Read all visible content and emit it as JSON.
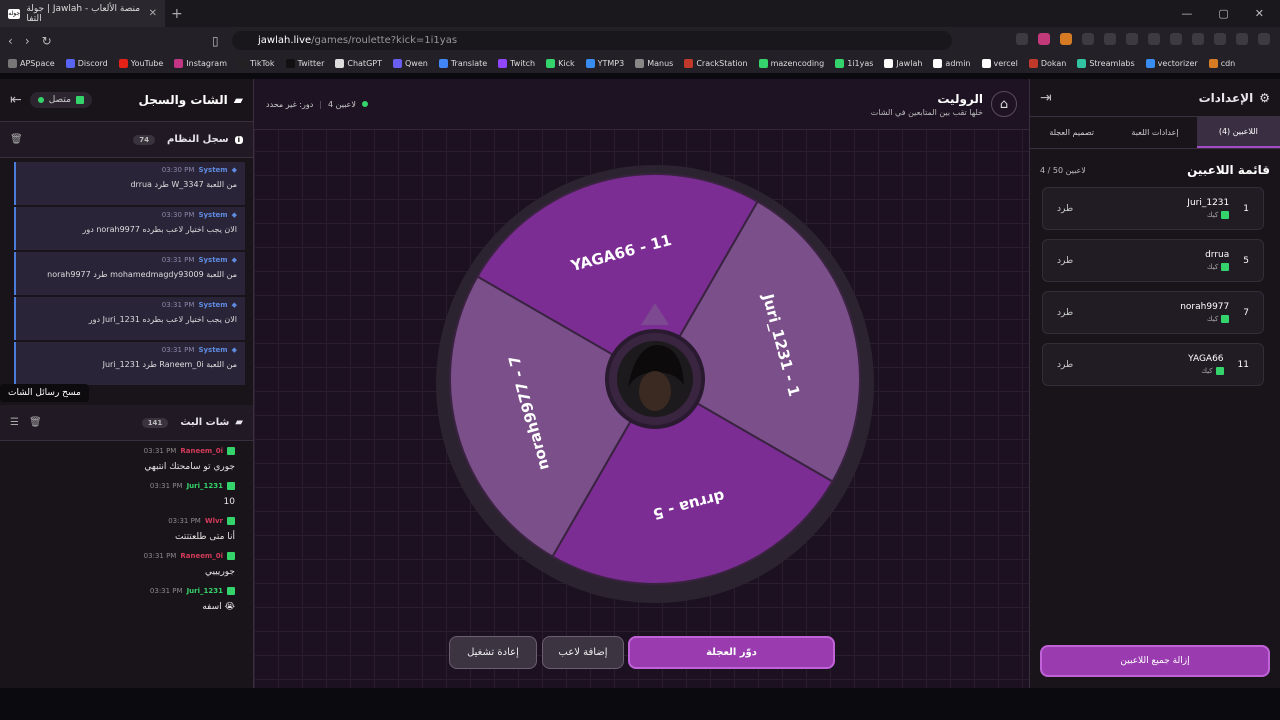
{
  "browser": {
    "tab_title": "جولة | Jawlah - منصة الألعاب التفا",
    "tab_fav": "جوله",
    "url_site": "jawlah.live",
    "url_path": "/games/roulette?kick=1i1yas"
  },
  "bookmarks": [
    "APSpace",
    "Discord",
    "YouTube",
    "Instagram",
    "TikTok",
    "Twitter",
    "ChatGPT",
    "Qwen",
    "Translate",
    "Twitch",
    "Kick",
    "YTMP3",
    "Manus",
    "CrackStation",
    "mazencoding",
    "1i1yas",
    "Jawlah",
    "admin",
    "vercel",
    "Dokan",
    "Streamlabs",
    "vectorizer",
    "cdn"
  ],
  "left": {
    "title": "الشات والسجل",
    "status": "متصل",
    "system_log": {
      "title": "سجل النظام",
      "count": "74"
    },
    "system_messages": [
      {
        "author": "System",
        "time": "03:30 PM",
        "text": "drrua طرد W_3347 من اللعبة"
      },
      {
        "author": "System",
        "time": "03:30 PM",
        "text": "دور norah9977 الان يجب اختيار لاعب بطرده"
      },
      {
        "author": "System",
        "time": "03:31 PM",
        "text": "norah9977 طرد mohamedmagdy93009 من اللعبة"
      },
      {
        "author": "System",
        "time": "03:31 PM",
        "text": "دور Juri_1231 الان يجب اختيار لاعب بطرده"
      },
      {
        "author": "System",
        "time": "03:31 PM",
        "text": "Juri_1231 طرد Raneem_0i من اللعبة"
      }
    ],
    "tooltip": "مسح رسائل الشات",
    "stream_chat": {
      "title": "شات البث",
      "count": "141"
    },
    "chat_messages": [
      {
        "author": "Raneem_0i",
        "color": "#d23b5b",
        "time": "03:31 PM",
        "text": "جوري تو سامحتك انتبهي"
      },
      {
        "author": "Juri_1231",
        "color": "#35d36b",
        "time": "03:31 PM",
        "text": "10"
      },
      {
        "author": "Wlvr",
        "color": "#d23b5b",
        "time": "03:31 PM",
        "text": "أنا متى طلعتتتت"
      },
      {
        "author": "Raneem_0i",
        "color": "#d23b5b",
        "time": "03:31 PM",
        "text": "جوريييي"
      },
      {
        "author": "Juri_1231",
        "color": "#35d36b",
        "time": "03:31 PM",
        "text": "اسفه 😭"
      }
    ]
  },
  "center": {
    "title": "الروليت",
    "subtitle": "خلها تقب بين المتابعين في الشات",
    "players_count": "4 لاعبين",
    "turn": "دور: غير محدد",
    "segments": [
      {
        "label": "Juri_1231 - 1",
        "color": "#7a4f8a"
      },
      {
        "label": "drrua - 5",
        "color": "#7b2d94"
      },
      {
        "label": "norah9977 - 7",
        "color": "#7a4f8a"
      },
      {
        "label": "YAGA66 - 11",
        "color": "#7b2d94"
      }
    ],
    "spin_label": "دوّر العجلة",
    "add_label": "إضافة لاعب",
    "reset_label": "إعادة تشغيل"
  },
  "right": {
    "title": "الإعدادات",
    "tabs": [
      "اللاعبين (4)",
      "إعدادات اللعبة",
      "تصميم العجلة"
    ],
    "list_title": "قائمة اللاعبين",
    "capacity": "4 / 50 لاعبين",
    "players": [
      {
        "num": "1",
        "name": "Juri_1231",
        "platform": "كيك",
        "kick": "طرد"
      },
      {
        "num": "5",
        "name": "drrua",
        "platform": "كيك",
        "kick": "طرد"
      },
      {
        "num": "7",
        "name": "norah9977",
        "platform": "كيك",
        "kick": "طرد"
      },
      {
        "num": "11",
        "name": "YAGA66",
        "platform": "كيك",
        "kick": "طرد"
      }
    ],
    "remove_all": "إزالة جميع اللاعبين"
  }
}
